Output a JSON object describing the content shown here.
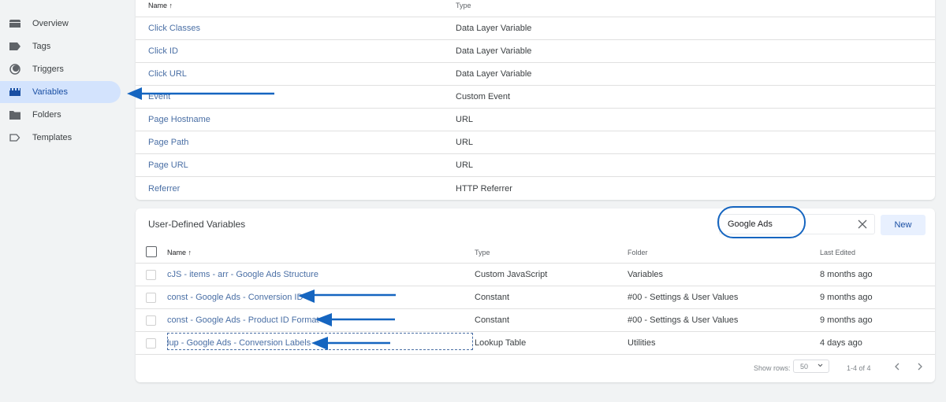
{
  "sidebar": {
    "items": [
      {
        "label": "Overview",
        "icon": "overview-icon",
        "active": false
      },
      {
        "label": "Tags",
        "icon": "tag-icon",
        "active": false
      },
      {
        "label": "Triggers",
        "icon": "trigger-icon",
        "active": false
      },
      {
        "label": "Variables",
        "icon": "variables-icon",
        "active": true
      },
      {
        "label": "Folders",
        "icon": "folder-icon",
        "active": false
      },
      {
        "label": "Templates",
        "icon": "template-icon",
        "active": false
      }
    ]
  },
  "builtin": {
    "headers": {
      "name": "Name",
      "sort_icon": "↑",
      "type": "Type"
    },
    "rows": [
      {
        "name": "Click Classes",
        "type": "Data Layer Variable"
      },
      {
        "name": "Click ID",
        "type": "Data Layer Variable"
      },
      {
        "name": "Click URL",
        "type": "Data Layer Variable"
      },
      {
        "name": "Event",
        "type": "Custom Event"
      },
      {
        "name": "Page Hostname",
        "type": "URL"
      },
      {
        "name": "Page Path",
        "type": "URL"
      },
      {
        "name": "Page URL",
        "type": "URL"
      },
      {
        "name": "Referrer",
        "type": "HTTP Referrer"
      }
    ]
  },
  "user_defined": {
    "title": "User-Defined Variables",
    "search": {
      "value": "Google Ads"
    },
    "new_label": "New",
    "headers": {
      "name": "Name",
      "sort_icon": "↑",
      "type": "Type",
      "folder": "Folder",
      "last_edited": "Last Edited"
    },
    "rows": [
      {
        "name": "cJS - items - arr - Google Ads Structure",
        "type": "Custom JavaScript",
        "folder": "Variables",
        "last_edited": "8 months ago"
      },
      {
        "name": "const - Google Ads - Conversion ID",
        "type": "Constant",
        "folder": "#00 - Settings & User Values",
        "last_edited": "9 months ago"
      },
      {
        "name": "const - Google Ads - Product ID Format",
        "type": "Constant",
        "folder": "#00 - Settings & User Values",
        "last_edited": "9 months ago"
      },
      {
        "name": "lup - Google Ads - Conversion Labels",
        "type": "Lookup Table",
        "folder": "Utilities",
        "last_edited": "4 days ago"
      }
    ],
    "footer": {
      "show_rows_label": "Show rows:",
      "rows_per_page": "50",
      "range": "1-4 of 4"
    }
  },
  "annotation_color": "#1565c0"
}
